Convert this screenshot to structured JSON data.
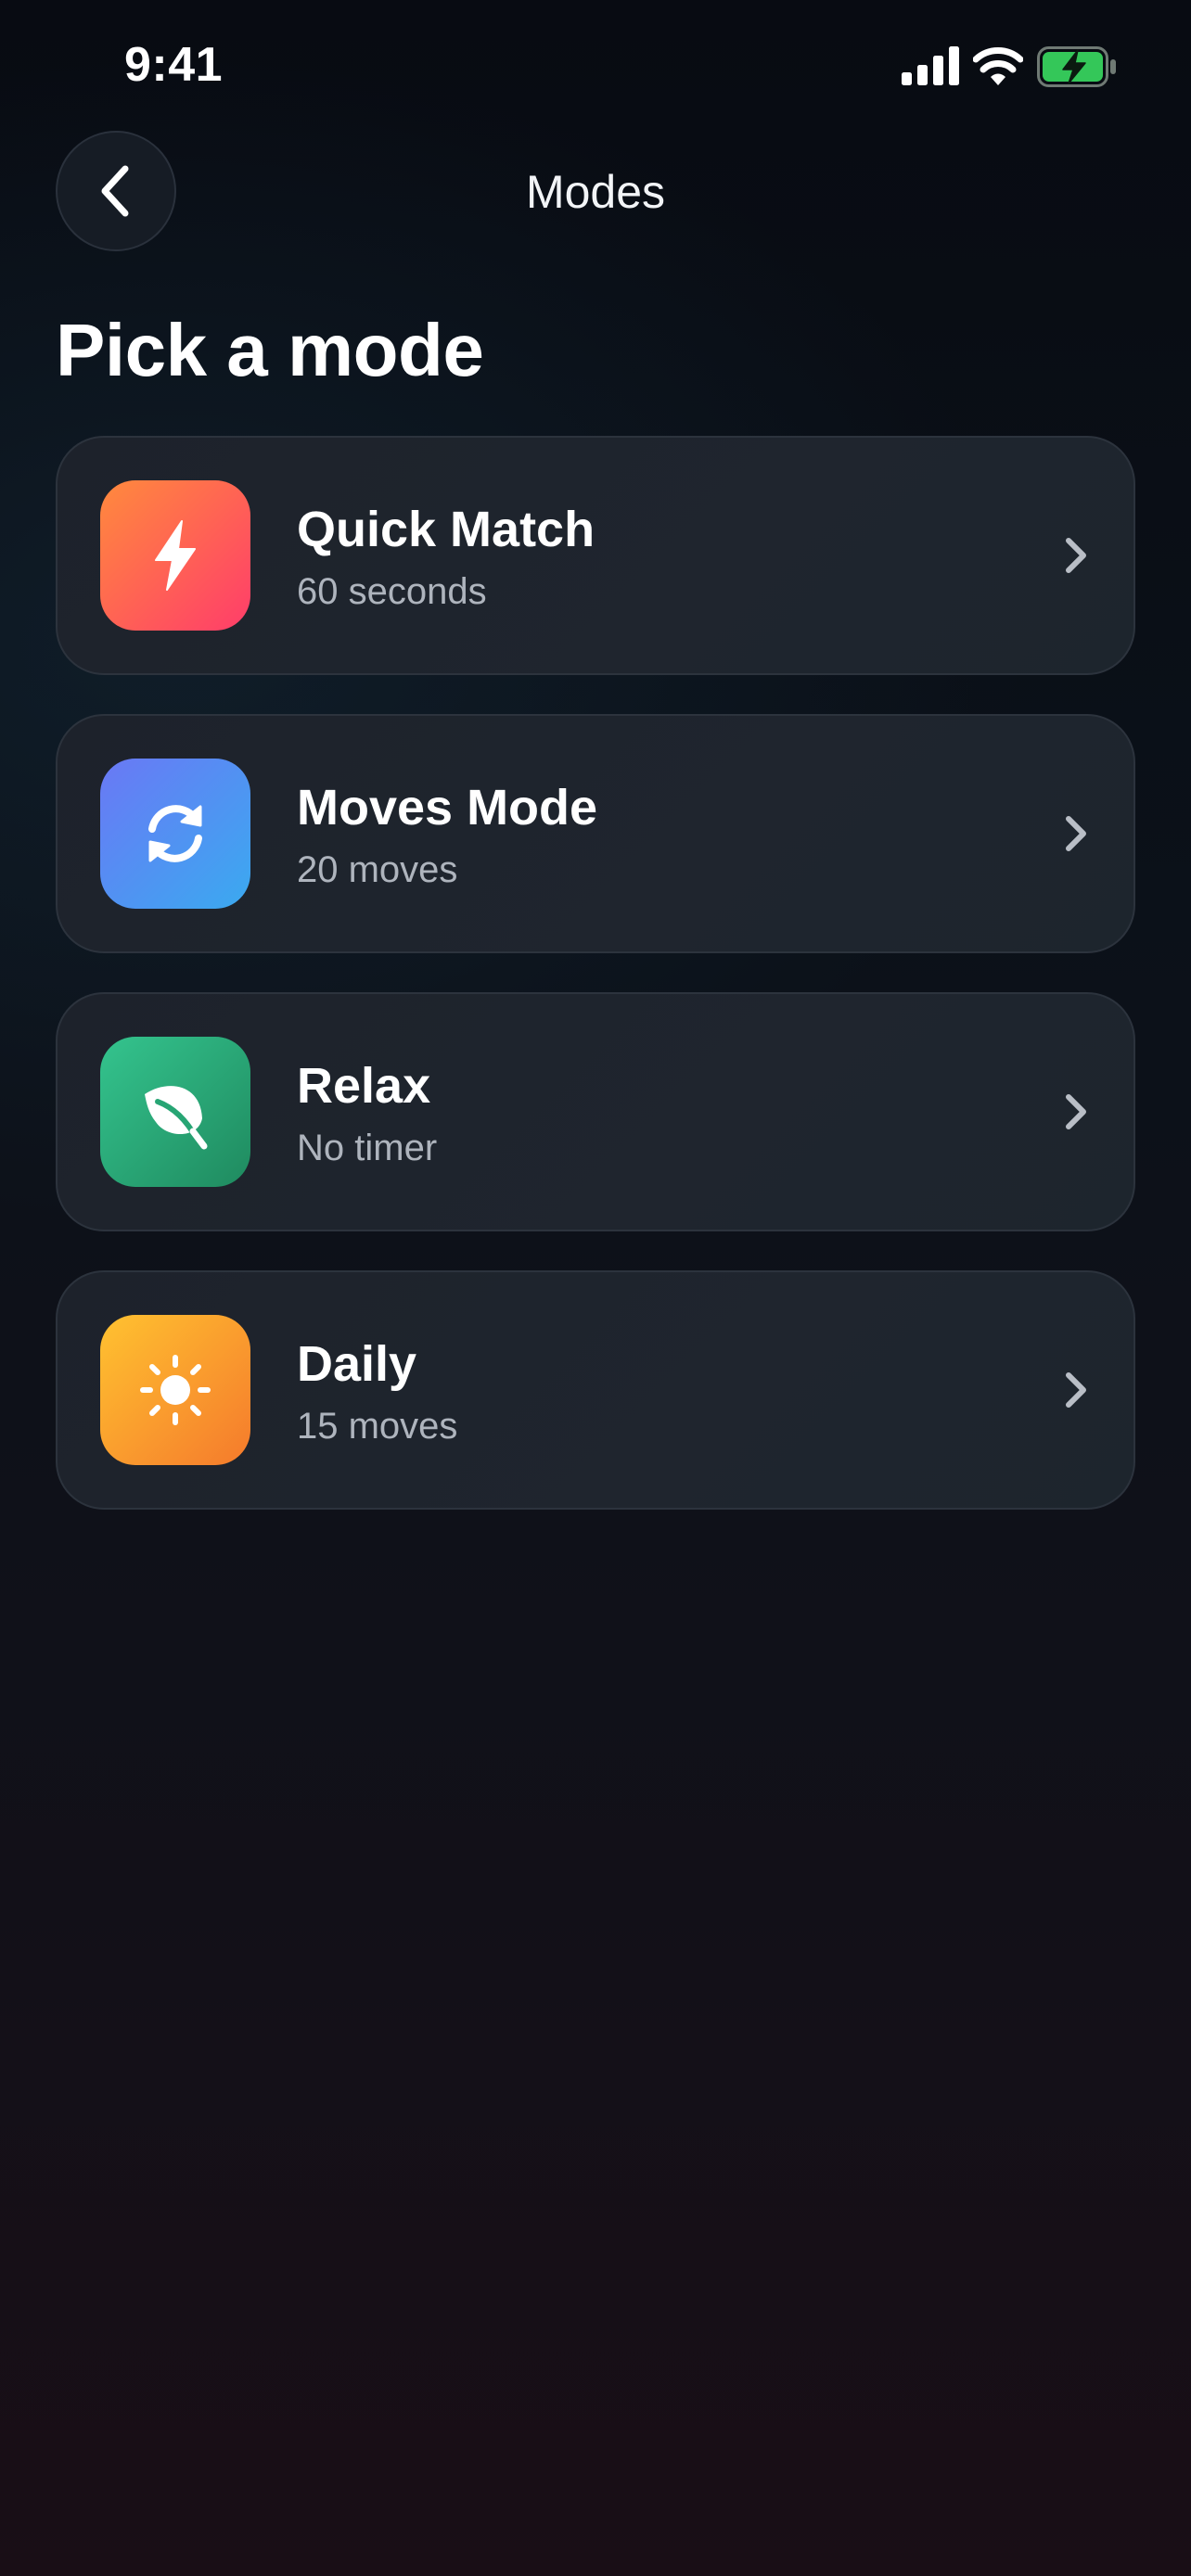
{
  "status_bar": {
    "time": "9:41",
    "icons": [
      "signal-icon",
      "wifi-icon",
      "battery-charging-icon"
    ]
  },
  "nav": {
    "back_icon": "chevron-left-icon",
    "title": "Modes"
  },
  "page": {
    "title": "Pick a mode"
  },
  "modes": [
    {
      "title": "Quick Match",
      "subtitle": "60 seconds",
      "icon": "lightning-icon",
      "colors": [
        "#ff8a3d",
        "#ff3d6a"
      ]
    },
    {
      "title": "Moves Mode",
      "subtitle": "20 moves",
      "icon": "refresh-icon",
      "colors": [
        "#6a78f5",
        "#3aaaf0"
      ]
    },
    {
      "title": "Relax",
      "subtitle": "No timer",
      "icon": "leaf-icon",
      "colors": [
        "#2fbe88",
        "#1f8a5f"
      ]
    },
    {
      "title": "Daily",
      "subtitle": "15 moves",
      "icon": "sun-icon",
      "colors": [
        "#ffc230",
        "#f57a2c"
      ]
    }
  ],
  "colors": {
    "card_background": "#1f252e",
    "card_border": "#2c333d",
    "subtitle_text": "#aeb4bd",
    "battery_fill": "#34c759"
  }
}
